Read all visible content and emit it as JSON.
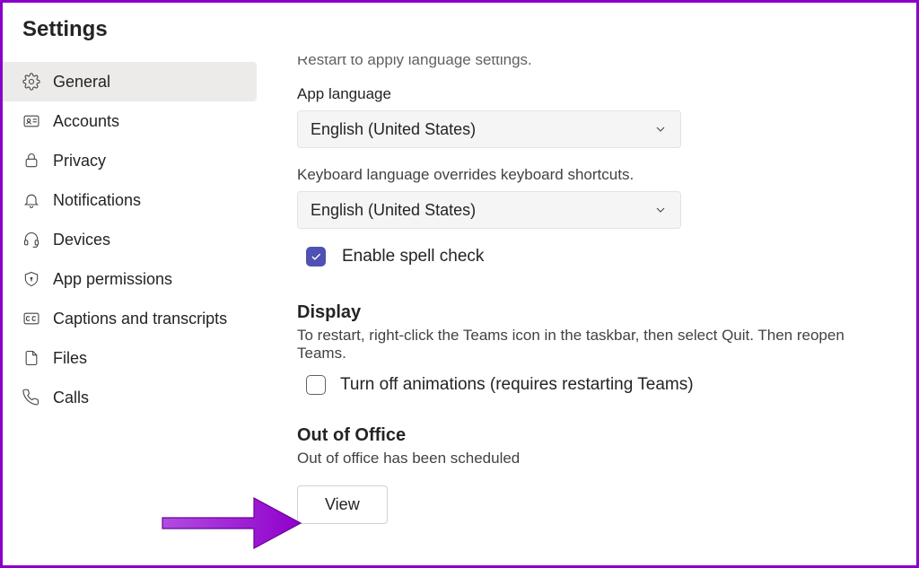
{
  "title": "Settings",
  "sidebar": {
    "items": [
      {
        "label": "General"
      },
      {
        "label": "Accounts"
      },
      {
        "label": "Privacy"
      },
      {
        "label": "Notifications"
      },
      {
        "label": "Devices"
      },
      {
        "label": "App permissions"
      },
      {
        "label": "Captions and transcripts"
      },
      {
        "label": "Files"
      },
      {
        "label": "Calls"
      }
    ]
  },
  "language": {
    "cutoff_hint": "Restart to apply language settings.",
    "app_label": "App language",
    "app_value": "English (United States)",
    "kb_helper": "Keyboard language overrides keyboard shortcuts.",
    "kb_value": "English (United States)",
    "spellcheck_label": "Enable spell check"
  },
  "display": {
    "heading": "Display",
    "desc": "To restart, right-click the Teams icon in the taskbar, then select Quit. Then reopen Teams.",
    "animations_label": "Turn off animations (requires restarting Teams)"
  },
  "ooo": {
    "heading": "Out of Office",
    "status": "Out of office has been scheduled",
    "view_label": "View"
  }
}
